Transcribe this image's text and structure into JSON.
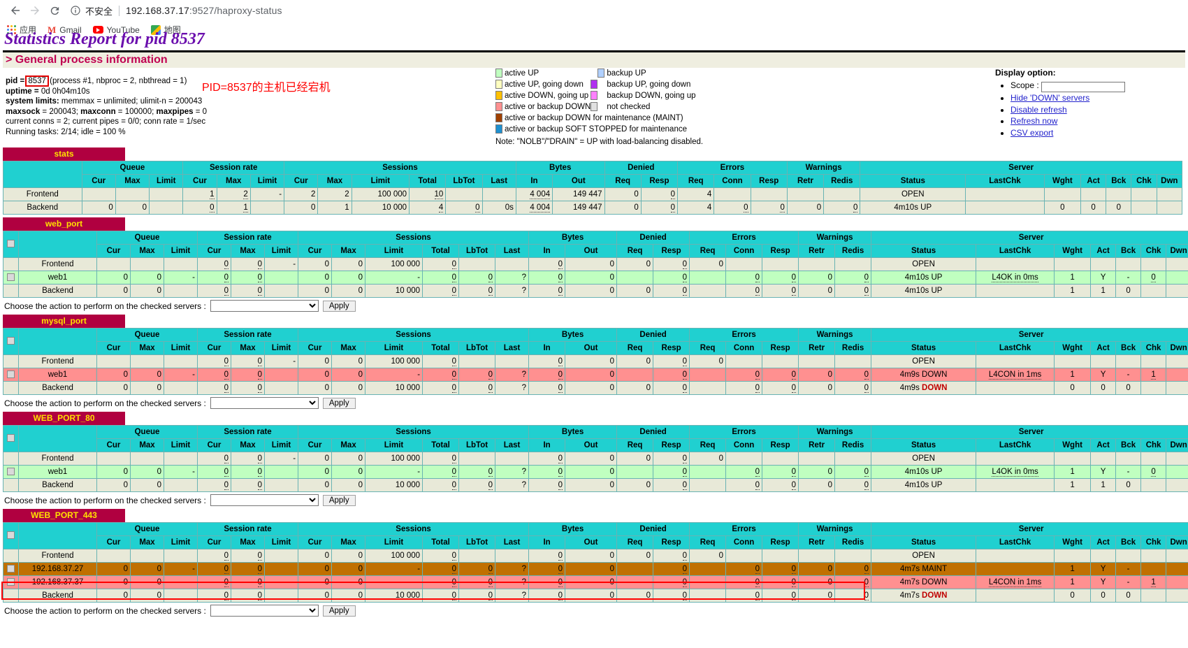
{
  "browser": {
    "back_icon": "back-arrow-icon",
    "forward_icon": "forward-arrow-icon",
    "reload_icon": "reload-icon",
    "info_icon": "info-circle-icon",
    "insecure_label": "不安全",
    "url_host": "192.168.37.17",
    "url_rest": ":9527/haproxy-status",
    "bookmarks": [
      {
        "label": "应用",
        "icon": "apps-grid-icon"
      },
      {
        "label": "Gmail",
        "icon": "gmail-icon"
      },
      {
        "label": "YouTube",
        "icon": "youtube-icon"
      },
      {
        "label": "地图",
        "icon": "maps-icon"
      }
    ]
  },
  "page": {
    "title": "Statistics Report for pid 8537",
    "section_title": "> General process information",
    "annotation": "PID=8537的主机已经宕机"
  },
  "process": {
    "pid_label": "pid = ",
    "pid_value": "8537",
    "pid_suffix": " (process #1, nbproc = 2, nbthread = 1)",
    "uptime_label": "uptime = ",
    "uptime_value": "0d 0h04m10s",
    "limits_label": "system limits:",
    "limits_value": " memmax = unlimited; ulimit-n = 200043",
    "maxsock_label": "maxsock",
    "maxsock_value": " = 200043; ",
    "maxconn_label": "maxconn",
    "maxconn_value": " = 100000; ",
    "maxpipes_label": "maxpipes",
    "maxpipes_value": " = 0",
    "conns_line": "current conns = 2; current pipes = 0/0; conn rate = 1/sec",
    "tasks_line": "Running tasks: 2/14; idle = 100 %"
  },
  "legend": {
    "items_left": [
      {
        "label": "active UP",
        "color": "#c0ffc0"
      },
      {
        "label": "active UP, going down",
        "color": "#ffffc0"
      },
      {
        "label": "active DOWN, going up",
        "color": "#ffc000"
      },
      {
        "label": "active or backup DOWN",
        "color": "#ff9090"
      },
      {
        "label": "active or backup DOWN for maintenance (MAINT)",
        "color": "#a04000"
      },
      {
        "label": "active or backup SOFT STOPPED for maintenance",
        "color": "#1e90d0"
      }
    ],
    "items_right": [
      {
        "label": "backup UP",
        "color": "#b0d0ff"
      },
      {
        "label": "backup UP, going down",
        "color": "#b030f0"
      },
      {
        "label": "backup DOWN, going up",
        "color": "#ff80ff"
      },
      {
        "label": "not checked",
        "color": "#e0e0e0"
      }
    ],
    "note": "Note: \"NOLB\"/\"DRAIN\" = UP with load-balancing disabled."
  },
  "display_option": {
    "title": "Display option:",
    "scope_label": "Scope :",
    "scope_value": "",
    "links": [
      "Hide 'DOWN' servers",
      "Disable refresh",
      "Refresh now",
      "CSV export"
    ]
  },
  "columns": {
    "groups": [
      "Queue",
      "Session rate",
      "Sessions",
      "Bytes",
      "Denied",
      "Errors",
      "Warnings",
      "Server"
    ],
    "queue": [
      "Cur",
      "Max",
      "Limit"
    ],
    "session_rate": [
      "Cur",
      "Max",
      "Limit"
    ],
    "sessions": [
      "Cur",
      "Max",
      "Limit",
      "Total",
      "LbTot",
      "Last"
    ],
    "bytes": [
      "In",
      "Out"
    ],
    "denied": [
      "Req",
      "Resp"
    ],
    "errors": [
      "Req",
      "Conn",
      "Resp"
    ],
    "warnings": [
      "Retr",
      "Redis"
    ],
    "server": [
      "Status",
      "LastChk",
      "Wght",
      "Act",
      "Bck",
      "Chk",
      "Dwn"
    ]
  },
  "action_bar": {
    "label": "Choose the action to perform on the checked servers :",
    "select_value": "",
    "apply_label": "Apply"
  },
  "proxies": [
    {
      "name": "stats",
      "has_checkbox": false,
      "rows": [
        {
          "kind": "frontend",
          "name": "Frontend",
          "q_cur": "",
          "q_max": "",
          "q_limit": "",
          "sr_cur": "1",
          "sr_max": "2",
          "sr_limit": "-",
          "s_cur": "2",
          "s_max": "2",
          "s_limit": "100 000",
          "s_total": "10",
          "s_lbtot": "",
          "s_last": "",
          "b_in": "4 004",
          "b_out": "149 447",
          "d_req": "0",
          "d_resp": "0",
          "e_req": "4",
          "e_conn": "",
          "e_resp": "",
          "w_retr": "",
          "w_redis": "",
          "status": "OPEN",
          "lastchk": "",
          "wght": "",
          "act": "",
          "bck": "",
          "chk": "",
          "dwn": ""
        },
        {
          "kind": "backend",
          "name": "Backend",
          "q_cur": "0",
          "q_max": "0",
          "q_limit": "",
          "sr_cur": "0",
          "sr_max": "1",
          "sr_limit": "",
          "s_cur": "0",
          "s_max": "1",
          "s_limit": "10 000",
          "s_total": "4",
          "s_lbtot": "0",
          "s_last": "0s",
          "b_in": "4 004",
          "b_out": "149 447",
          "d_req": "0",
          "d_resp": "0",
          "e_req": "4",
          "e_conn": "0",
          "e_resp": "0",
          "w_retr": "0",
          "w_redis": "0",
          "status": "4m10s UP",
          "lastchk": "",
          "wght": "0",
          "act": "0",
          "bck": "0",
          "chk": "",
          "dwn": ""
        }
      ]
    },
    {
      "name": "web_port",
      "has_checkbox": true,
      "rows": [
        {
          "kind": "frontend",
          "name": "Frontend",
          "q_cur": "",
          "q_max": "",
          "q_limit": "",
          "sr_cur": "0",
          "sr_max": "0",
          "sr_limit": "-",
          "s_cur": "0",
          "s_max": "0",
          "s_limit": "100 000",
          "s_total": "0",
          "s_lbtot": "",
          "s_last": "",
          "b_in": "0",
          "b_out": "0",
          "d_req": "0",
          "d_resp": "0",
          "e_req": "0",
          "e_conn": "",
          "e_resp": "",
          "w_retr": "",
          "w_redis": "",
          "status": "OPEN",
          "lastchk": "",
          "wght": "",
          "act": "",
          "bck": "",
          "chk": "",
          "dwn": ""
        },
        {
          "kind": "up",
          "name": "web1",
          "checkbox": true,
          "q_cur": "0",
          "q_max": "0",
          "q_limit": "-",
          "sr_cur": "0",
          "sr_max": "0",
          "sr_limit": "",
          "s_cur": "0",
          "s_max": "0",
          "s_limit": "-",
          "s_total": "0",
          "s_lbtot": "0",
          "s_last": "?",
          "b_in": "0",
          "b_out": "0",
          "d_req": "",
          "d_resp": "0",
          "e_req": "",
          "e_conn": "0",
          "e_resp": "0",
          "w_retr": "0",
          "w_redis": "0",
          "status": "4m10s UP",
          "lastchk": "L4OK in 0ms",
          "wght": "1",
          "act": "Y",
          "bck": "-",
          "chk": "0",
          "dwn": ""
        },
        {
          "kind": "backend",
          "name": "Backend",
          "q_cur": "0",
          "q_max": "0",
          "q_limit": "",
          "sr_cur": "0",
          "sr_max": "0",
          "sr_limit": "",
          "s_cur": "0",
          "s_max": "0",
          "s_limit": "10 000",
          "s_total": "0",
          "s_lbtot": "0",
          "s_last": "?",
          "b_in": "0",
          "b_out": "0",
          "d_req": "0",
          "d_resp": "0",
          "e_req": "",
          "e_conn": "0",
          "e_resp": "0",
          "w_retr": "0",
          "w_redis": "0",
          "status": "4m10s UP",
          "lastchk": "",
          "wght": "1",
          "act": "1",
          "bck": "0",
          "chk": "",
          "dwn": ""
        }
      ]
    },
    {
      "name": "mysql_port",
      "has_checkbox": true,
      "rows": [
        {
          "kind": "frontend",
          "name": "Frontend",
          "q_cur": "",
          "q_max": "",
          "q_limit": "",
          "sr_cur": "0",
          "sr_max": "0",
          "sr_limit": "-",
          "s_cur": "0",
          "s_max": "0",
          "s_limit": "100 000",
          "s_total": "0",
          "s_lbtot": "",
          "s_last": "",
          "b_in": "0",
          "b_out": "0",
          "d_req": "0",
          "d_resp": "0",
          "e_req": "0",
          "e_conn": "",
          "e_resp": "",
          "w_retr": "",
          "w_redis": "",
          "status": "OPEN",
          "lastchk": "",
          "wght": "",
          "act": "",
          "bck": "",
          "chk": "",
          "dwn": ""
        },
        {
          "kind": "down",
          "name": "web1",
          "checkbox": true,
          "q_cur": "0",
          "q_max": "0",
          "q_limit": "-",
          "sr_cur": "0",
          "sr_max": "0",
          "sr_limit": "",
          "s_cur": "0",
          "s_max": "0",
          "s_limit": "-",
          "s_total": "0",
          "s_lbtot": "0",
          "s_last": "?",
          "b_in": "0",
          "b_out": "0",
          "d_req": "",
          "d_resp": "0",
          "e_req": "",
          "e_conn": "0",
          "e_resp": "0",
          "w_retr": "0",
          "w_redis": "0",
          "status": "4m9s DOWN",
          "lastchk": "L4CON in 1ms",
          "wght": "1",
          "act": "Y",
          "bck": "-",
          "chk": "1",
          "dwn": ""
        },
        {
          "kind": "backend",
          "name": "Backend",
          "q_cur": "0",
          "q_max": "0",
          "q_limit": "",
          "sr_cur": "0",
          "sr_max": "0",
          "sr_limit": "",
          "s_cur": "0",
          "s_max": "0",
          "s_limit": "10 000",
          "s_total": "0",
          "s_lbtot": "0",
          "s_last": "?",
          "b_in": "0",
          "b_out": "0",
          "d_req": "0",
          "d_resp": "0",
          "e_req": "",
          "e_conn": "0",
          "e_resp": "0",
          "w_retr": "0",
          "w_redis": "0",
          "status": "4m9s DOWN",
          "lastchk": "",
          "wght": "0",
          "act": "0",
          "bck": "0",
          "chk": "",
          "dwn": ""
        }
      ]
    },
    {
      "name": "WEB_PORT_80",
      "has_checkbox": true,
      "rows": [
        {
          "kind": "frontend",
          "name": "Frontend",
          "q_cur": "",
          "q_max": "",
          "q_limit": "",
          "sr_cur": "0",
          "sr_max": "0",
          "sr_limit": "-",
          "s_cur": "0",
          "s_max": "0",
          "s_limit": "100 000",
          "s_total": "0",
          "s_lbtot": "",
          "s_last": "",
          "b_in": "0",
          "b_out": "0",
          "d_req": "0",
          "d_resp": "0",
          "e_req": "0",
          "e_conn": "",
          "e_resp": "",
          "w_retr": "",
          "w_redis": "",
          "status": "OPEN",
          "lastchk": "",
          "wght": "",
          "act": "",
          "bck": "",
          "chk": "",
          "dwn": ""
        },
        {
          "kind": "up",
          "name": "web1",
          "checkbox": true,
          "q_cur": "0",
          "q_max": "0",
          "q_limit": "-",
          "sr_cur": "0",
          "sr_max": "0",
          "sr_limit": "",
          "s_cur": "0",
          "s_max": "0",
          "s_limit": "-",
          "s_total": "0",
          "s_lbtot": "0",
          "s_last": "?",
          "b_in": "0",
          "b_out": "0",
          "d_req": "",
          "d_resp": "0",
          "e_req": "",
          "e_conn": "0",
          "e_resp": "0",
          "w_retr": "0",
          "w_redis": "0",
          "status": "4m10s UP",
          "lastchk": "L4OK in 0ms",
          "wght": "1",
          "act": "Y",
          "bck": "-",
          "chk": "0",
          "dwn": ""
        },
        {
          "kind": "backend",
          "name": "Backend",
          "q_cur": "0",
          "q_max": "0",
          "q_limit": "",
          "sr_cur": "0",
          "sr_max": "0",
          "sr_limit": "",
          "s_cur": "0",
          "s_max": "0",
          "s_limit": "10 000",
          "s_total": "0",
          "s_lbtot": "0",
          "s_last": "?",
          "b_in": "0",
          "b_out": "0",
          "d_req": "0",
          "d_resp": "0",
          "e_req": "",
          "e_conn": "0",
          "e_resp": "0",
          "w_retr": "0",
          "w_redis": "0",
          "status": "4m10s UP",
          "lastchk": "",
          "wght": "1",
          "act": "1",
          "bck": "0",
          "chk": "",
          "dwn": ""
        }
      ]
    },
    {
      "name": "WEB_PORT_443",
      "has_checkbox": true,
      "rows": [
        {
          "kind": "frontend",
          "name": "Frontend",
          "q_cur": "",
          "q_max": "",
          "q_limit": "",
          "sr_cur": "0",
          "sr_max": "0",
          "sr_limit": "",
          "s_cur": "0",
          "s_max": "0",
          "s_limit": "100 000",
          "s_total": "0",
          "s_lbtot": "",
          "s_last": "",
          "b_in": "0",
          "b_out": "0",
          "d_req": "0",
          "d_resp": "0",
          "e_req": "0",
          "e_conn": "",
          "e_resp": "",
          "w_retr": "",
          "w_redis": "",
          "status": "OPEN",
          "lastchk": "",
          "wght": "",
          "act": "",
          "bck": "",
          "chk": "",
          "dwn": ""
        },
        {
          "kind": "maint",
          "name": "192.168.37.27",
          "checkbox": true,
          "q_cur": "0",
          "q_max": "0",
          "q_limit": "-",
          "sr_cur": "0",
          "sr_max": "0",
          "sr_limit": "",
          "s_cur": "0",
          "s_max": "0",
          "s_limit": "-",
          "s_total": "0",
          "s_lbtot": "0",
          "s_last": "?",
          "b_in": "0",
          "b_out": "0",
          "d_req": "",
          "d_resp": "0",
          "e_req": "",
          "e_conn": "0",
          "e_resp": "0",
          "w_retr": "0",
          "w_redis": "0",
          "status": "4m7s MAINT",
          "lastchk": "",
          "wght": "1",
          "act": "Y",
          "bck": "-",
          "chk": "",
          "dwn": ""
        },
        {
          "kind": "down",
          "name": "192.168.37.37",
          "checkbox": true,
          "q_cur": "0",
          "q_max": "0",
          "q_limit": "-",
          "sr_cur": "0",
          "sr_max": "0",
          "sr_limit": "",
          "s_cur": "0",
          "s_max": "0",
          "s_limit": "-",
          "s_total": "0",
          "s_lbtot": "0",
          "s_last": "?",
          "b_in": "0",
          "b_out": "0",
          "d_req": "",
          "d_resp": "0",
          "e_req": "",
          "e_conn": "0",
          "e_resp": "0",
          "w_retr": "0",
          "w_redis": "0",
          "status": "4m7s DOWN",
          "lastchk": "L4CON in 1ms",
          "wght": "1",
          "act": "Y",
          "bck": "-",
          "chk": "1",
          "dwn": ""
        },
        {
          "kind": "backend",
          "name": "Backend",
          "q_cur": "0",
          "q_max": "0",
          "q_limit": "",
          "sr_cur": "0",
          "sr_max": "0",
          "sr_limit": "",
          "s_cur": "0",
          "s_max": "0",
          "s_limit": "10 000",
          "s_total": "0",
          "s_lbtot": "0",
          "s_last": "?",
          "b_in": "0",
          "b_out": "0",
          "d_req": "0",
          "d_resp": "0",
          "e_req": "",
          "e_conn": "0",
          "e_resp": "0",
          "w_retr": "0",
          "w_redis": "0",
          "status": "4m7s DOWN",
          "lastchk": "",
          "wght": "0",
          "act": "0",
          "bck": "0",
          "chk": "",
          "dwn": ""
        }
      ]
    }
  ]
}
